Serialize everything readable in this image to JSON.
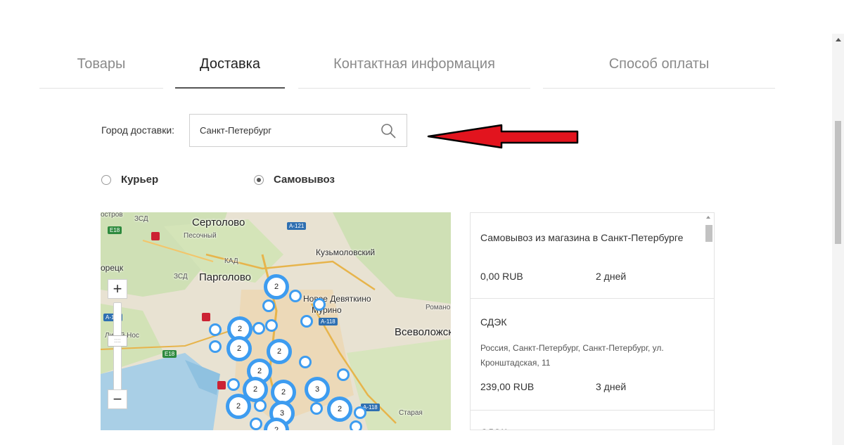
{
  "tabs": [
    {
      "label": "Товары"
    },
    {
      "label": "Доставка"
    },
    {
      "label": "Контактная информация"
    },
    {
      "label": "Способ оплаты"
    }
  ],
  "city": {
    "label": "Город доставки:",
    "value": "Санкт-Петербург"
  },
  "delivery_options": [
    {
      "label": "Курьер",
      "selected": false
    },
    {
      "label": "Самовывоз",
      "selected": true
    }
  ],
  "map": {
    "zoom_in": "+",
    "zoom_out": "−",
    "zoom_handle": "::::",
    "labels": {
      "sertolovo": "Сертолово",
      "pesochny": "Песочный",
      "kuzmolovsky": "Кузьмоловский",
      "pargolovo": "Парголово",
      "kad": "КАД",
      "zsd": "ЗСД",
      "novoe_devyatkino": "Новое Девяткино",
      "murino": "Мурино",
      "vsevolozhsk": "Всеволожск",
      "romanovka": "Романо",
      "lisy_nos": "Лисий Нос",
      "staraya": "Старая",
      "orets": "орецк",
      "ostrov": "остров"
    },
    "road_badges": {
      "e18": "E18",
      "a121": "A-121",
      "a118": "A-118"
    },
    "clusters": [
      "2",
      "2",
      "2",
      "2",
      "2",
      "2",
      "2",
      "3",
      "2",
      "2",
      "3",
      "2"
    ]
  },
  "pickup_list": [
    {
      "name": "Самовывоз из магазина в Санкт-Петербурге",
      "address": "",
      "price": "0,00 RUB",
      "days": "2 дней"
    },
    {
      "name": "СДЭК",
      "address": "Россия, Санкт-Петербург, Санкт-Петербург, ул. Кронштадская, 11",
      "price": "239,00 RUB",
      "days": "3 дней"
    },
    {
      "name": "СДЭК",
      "address": "",
      "price": "",
      "days": ""
    }
  ],
  "colors": {
    "marker": "#3d9cf0",
    "arrow": "#e2141e",
    "active_tab": "#222222"
  }
}
